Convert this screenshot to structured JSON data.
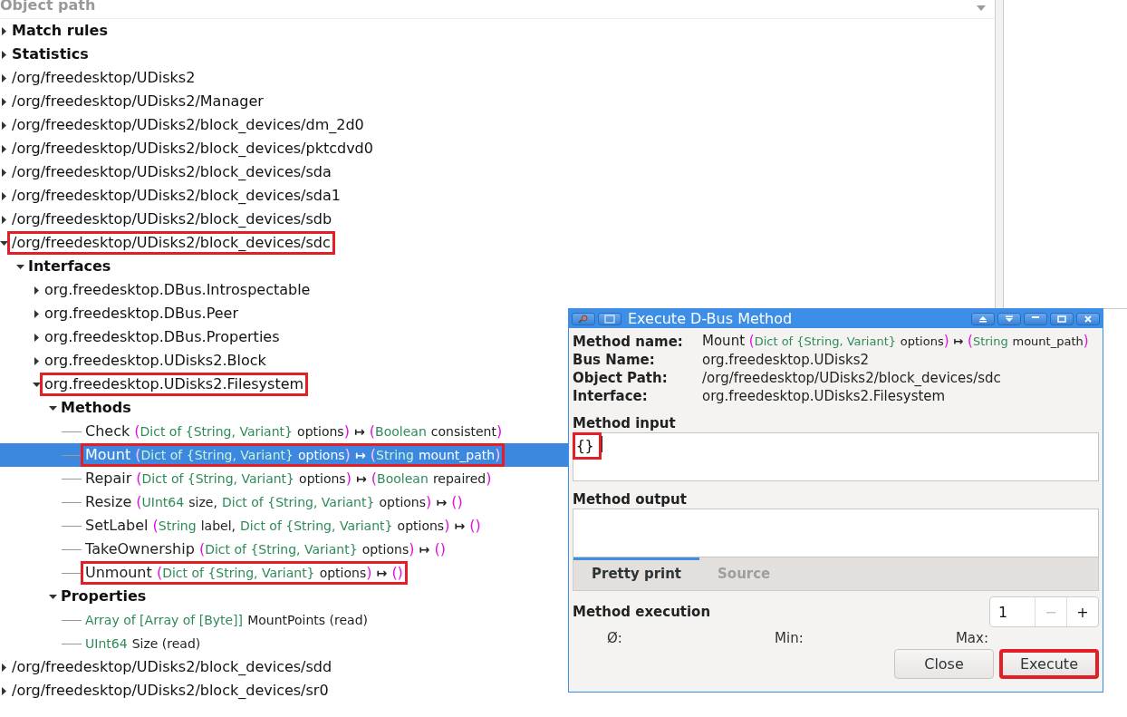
{
  "tree": {
    "header": "Object path",
    "items": [
      {
        "kind": "node",
        "label": "Match rules",
        "bold": true,
        "expanded": false,
        "highlighted": false
      },
      {
        "kind": "node",
        "label": "Statistics",
        "bold": true,
        "expanded": false,
        "highlighted": false
      },
      {
        "kind": "node",
        "label": "/org/freedesktop/UDisks2",
        "bold": false,
        "expanded": false,
        "highlighted": false
      },
      {
        "kind": "node",
        "label": "/org/freedesktop/UDisks2/Manager",
        "bold": false,
        "expanded": false,
        "highlighted": false
      },
      {
        "kind": "node",
        "label": "/org/freedesktop/UDisks2/block_devices/dm_2d0",
        "bold": false,
        "expanded": false,
        "highlighted": false
      },
      {
        "kind": "node",
        "label": "/org/freedesktop/UDisks2/block_devices/pktcdvd0",
        "bold": false,
        "expanded": false,
        "highlighted": false
      },
      {
        "kind": "node",
        "label": "/org/freedesktop/UDisks2/block_devices/sda",
        "bold": false,
        "expanded": false,
        "highlighted": false
      },
      {
        "kind": "node",
        "label": "/org/freedesktop/UDisks2/block_devices/sda1",
        "bold": false,
        "expanded": false,
        "highlighted": false
      },
      {
        "kind": "node",
        "label": "/org/freedesktop/UDisks2/block_devices/sdb",
        "bold": false,
        "expanded": false,
        "highlighted": false
      },
      {
        "kind": "node",
        "label": "/org/freedesktop/UDisks2/block_devices/sdc",
        "bold": false,
        "expanded": true,
        "highlighted": true,
        "children": [
          {
            "kind": "node",
            "label": "Interfaces",
            "bold": true,
            "expanded": true,
            "highlighted": false,
            "children": [
              {
                "kind": "node",
                "label": "org.freedesktop.DBus.Introspectable",
                "bold": false,
                "expanded": false,
                "highlighted": false
              },
              {
                "kind": "node",
                "label": "org.freedesktop.DBus.Peer",
                "bold": false,
                "expanded": false,
                "highlighted": false
              },
              {
                "kind": "node",
                "label": "org.freedesktop.DBus.Properties",
                "bold": false,
                "expanded": false,
                "highlighted": false
              },
              {
                "kind": "node",
                "label": "org.freedesktop.UDisks2.Block",
                "bold": false,
                "expanded": false,
                "highlighted": false
              },
              {
                "kind": "node",
                "label": "org.freedesktop.UDisks2.Filesystem",
                "bold": false,
                "expanded": true,
                "highlighted": true,
                "children": [
                  {
                    "kind": "node",
                    "label": "Methods",
                    "bold": true,
                    "expanded": true,
                    "highlighted": false,
                    "children": [
                      {
                        "kind": "leaf",
                        "selected": false,
                        "highlighted": false,
                        "segments": [
                          {
                            "kind": "name",
                            "text": "Check"
                          },
                          {
                            "kind": "lparen",
                            "text": "("
                          },
                          {
                            "kind": "type",
                            "text": "Dict of {String, Variant}"
                          },
                          {
                            "kind": "param",
                            "text": "options"
                          },
                          {
                            "kind": "rparen",
                            "text": ")"
                          },
                          {
                            "kind": "arrow",
                            "text": "↦"
                          },
                          {
                            "kind": "lparen",
                            "text": "("
                          },
                          {
                            "kind": "type",
                            "text": "Boolean"
                          },
                          {
                            "kind": "param",
                            "text": "consistent"
                          },
                          {
                            "kind": "rparen",
                            "text": ")"
                          }
                        ]
                      },
                      {
                        "kind": "leaf",
                        "selected": true,
                        "highlighted": true,
                        "segments": [
                          {
                            "kind": "name",
                            "text": "Mount"
                          },
                          {
                            "kind": "lparen",
                            "text": "("
                          },
                          {
                            "kind": "type",
                            "text": "Dict of {String, Variant}"
                          },
                          {
                            "kind": "param",
                            "text": "options"
                          },
                          {
                            "kind": "rparen",
                            "text": ")"
                          },
                          {
                            "kind": "arrow",
                            "text": "↦"
                          },
                          {
                            "kind": "lparen",
                            "text": "("
                          },
                          {
                            "kind": "type",
                            "text": "String"
                          },
                          {
                            "kind": "param",
                            "text": "mount_path"
                          },
                          {
                            "kind": "rparen",
                            "text": ")"
                          }
                        ]
                      },
                      {
                        "kind": "leaf",
                        "selected": false,
                        "highlighted": false,
                        "segments": [
                          {
                            "kind": "name",
                            "text": "Repair"
                          },
                          {
                            "kind": "lparen",
                            "text": "("
                          },
                          {
                            "kind": "type",
                            "text": "Dict of {String, Variant}"
                          },
                          {
                            "kind": "param",
                            "text": "options"
                          },
                          {
                            "kind": "rparen",
                            "text": ")"
                          },
                          {
                            "kind": "arrow",
                            "text": "↦"
                          },
                          {
                            "kind": "lparen",
                            "text": "("
                          },
                          {
                            "kind": "type",
                            "text": "Boolean"
                          },
                          {
                            "kind": "param",
                            "text": "repaired"
                          },
                          {
                            "kind": "rparen",
                            "text": ")"
                          }
                        ]
                      },
                      {
                        "kind": "leaf",
                        "selected": false,
                        "highlighted": false,
                        "segments": [
                          {
                            "kind": "name",
                            "text": "Resize"
                          },
                          {
                            "kind": "lparen",
                            "text": "("
                          },
                          {
                            "kind": "type",
                            "text": "UInt64"
                          },
                          {
                            "kind": "param",
                            "text": "size,"
                          },
                          {
                            "kind": "type",
                            "text": "Dict of {String, Variant}"
                          },
                          {
                            "kind": "param",
                            "text": "options"
                          },
                          {
                            "kind": "rparen",
                            "text": ")"
                          },
                          {
                            "kind": "arrow",
                            "text": "↦"
                          },
                          {
                            "kind": "unit",
                            "text": "()"
                          }
                        ]
                      },
                      {
                        "kind": "leaf",
                        "selected": false,
                        "highlighted": false,
                        "segments": [
                          {
                            "kind": "name",
                            "text": "SetLabel"
                          },
                          {
                            "kind": "lparen",
                            "text": "("
                          },
                          {
                            "kind": "type",
                            "text": "String"
                          },
                          {
                            "kind": "param",
                            "text": "label,"
                          },
                          {
                            "kind": "type",
                            "text": "Dict of {String, Variant}"
                          },
                          {
                            "kind": "param",
                            "text": "options"
                          },
                          {
                            "kind": "rparen",
                            "text": ")"
                          },
                          {
                            "kind": "arrow",
                            "text": "↦"
                          },
                          {
                            "kind": "unit",
                            "text": "()"
                          }
                        ]
                      },
                      {
                        "kind": "leaf",
                        "selected": false,
                        "highlighted": false,
                        "segments": [
                          {
                            "kind": "name",
                            "text": "TakeOwnership"
                          },
                          {
                            "kind": "lparen",
                            "text": "("
                          },
                          {
                            "kind": "type",
                            "text": "Dict of {String, Variant}"
                          },
                          {
                            "kind": "param",
                            "text": "options"
                          },
                          {
                            "kind": "rparen",
                            "text": ")"
                          },
                          {
                            "kind": "arrow",
                            "text": "↦"
                          },
                          {
                            "kind": "unit",
                            "text": "()"
                          }
                        ]
                      },
                      {
                        "kind": "leaf",
                        "selected": false,
                        "highlighted": true,
                        "segments": [
                          {
                            "kind": "name",
                            "text": "Unmount"
                          },
                          {
                            "kind": "lparen",
                            "text": "("
                          },
                          {
                            "kind": "type",
                            "text": "Dict of {String, Variant}"
                          },
                          {
                            "kind": "param",
                            "text": "options"
                          },
                          {
                            "kind": "rparen",
                            "text": ")"
                          },
                          {
                            "kind": "arrow",
                            "text": "↦"
                          },
                          {
                            "kind": "unit",
                            "text": "()"
                          }
                        ]
                      }
                    ]
                  },
                  {
                    "kind": "node",
                    "label": "Properties",
                    "bold": true,
                    "expanded": true,
                    "highlighted": false,
                    "children": [
                      {
                        "kind": "leaf",
                        "selected": false,
                        "highlighted": false,
                        "segments": [
                          {
                            "kind": "type",
                            "text": "Array of [Array of [Byte]]"
                          },
                          {
                            "kind": "param",
                            "text": "MountPoints (read)"
                          }
                        ]
                      },
                      {
                        "kind": "leaf",
                        "selected": false,
                        "highlighted": false,
                        "segments": [
                          {
                            "kind": "type",
                            "text": "UInt64"
                          },
                          {
                            "kind": "param",
                            "text": "Size (read)"
                          }
                        ]
                      }
                    ]
                  }
                ]
              }
            ]
          }
        ]
      },
      {
        "kind": "node",
        "label": "/org/freedesktop/UDisks2/block_devices/sdd",
        "bold": false,
        "expanded": false,
        "highlighted": false
      },
      {
        "kind": "node",
        "label": "/org/freedesktop/UDisks2/block_devices/sr0",
        "bold": false,
        "expanded": false,
        "highlighted": false
      }
    ]
  },
  "dialog": {
    "title": "Execute D-Bus Method",
    "info": [
      {
        "label": "Method name:",
        "segments": [
          {
            "kind": "name",
            "text": "Mount"
          },
          {
            "kind": "lparen",
            "text": "("
          },
          {
            "kind": "type",
            "text": "Dict of {String, Variant}"
          },
          {
            "kind": "param",
            "text": "options"
          },
          {
            "kind": "rparen",
            "text": ")"
          },
          {
            "kind": "arrow",
            "text": "↦"
          },
          {
            "kind": "lparen",
            "text": "("
          },
          {
            "kind": "type",
            "text": "String"
          },
          {
            "kind": "param",
            "text": "mount_path"
          },
          {
            "kind": "rparen",
            "text": ")"
          }
        ]
      },
      {
        "label": "Bus Name:",
        "value": "org.freedesktop.UDisks2"
      },
      {
        "label": "Object Path:",
        "value": "/org/freedesktop/UDisks2/block_devices/sdc"
      },
      {
        "label": "Interface:",
        "value": "org.freedesktop.UDisks2.Filesystem"
      }
    ],
    "input": {
      "label": "Method input",
      "value": "{}",
      "highlighted": true
    },
    "output": {
      "label": "Method output"
    },
    "tabs": [
      {
        "label": "Pretty print",
        "selected": true
      },
      {
        "label": "Source",
        "selected": false
      }
    ],
    "execution": {
      "label": "Method execution",
      "count": "1",
      "minus": "−",
      "plus": "+",
      "stats": [
        "Ø:",
        "Min:",
        "Max:"
      ]
    },
    "buttons": [
      {
        "label": "Close",
        "highlighted": false
      },
      {
        "label": "Execute",
        "highlighted": true
      }
    ]
  }
}
